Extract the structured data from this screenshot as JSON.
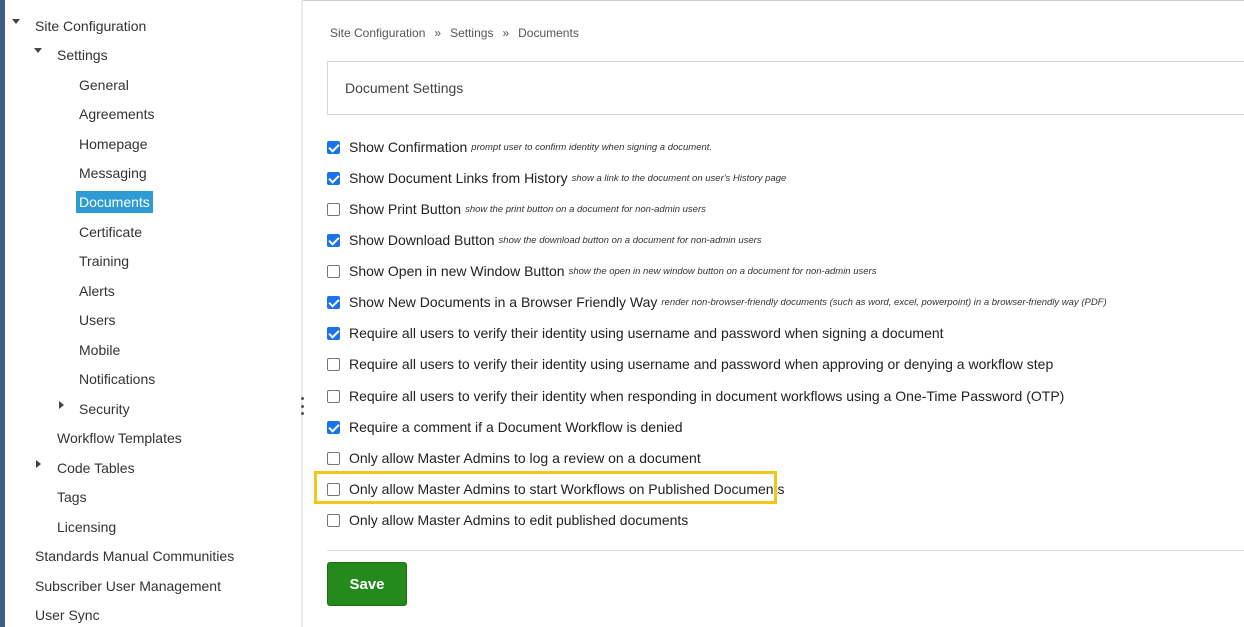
{
  "sidebar": {
    "site_configuration": "Site Configuration",
    "settings": "Settings",
    "settings_items": [
      "General",
      "Agreements",
      "Homepage",
      "Messaging",
      "Documents",
      "Certificate",
      "Training",
      "Alerts",
      "Users",
      "Mobile",
      "Notifications",
      "Security"
    ],
    "active_item": "Documents",
    "workflow_templates": "Workflow Templates",
    "code_tables": "Code Tables",
    "tags": "Tags",
    "licensing": "Licensing",
    "standards_manual_communities": "Standards Manual Communities",
    "subscriber_user_management": "Subscriber User Management",
    "user_sync": "User Sync",
    "active_color": "#2f9bd5"
  },
  "breadcrumb": {
    "items": [
      "Site Configuration",
      "Settings",
      "Documents"
    ],
    "separator": "»"
  },
  "panel": {
    "title": "Document Settings"
  },
  "options": [
    {
      "label": "Show Confirmation",
      "help": "prompt user to confirm identity when signing a document.",
      "checked": true
    },
    {
      "label": "Show Document Links from History",
      "help": "show a link to the document on user's History page",
      "checked": true
    },
    {
      "label": "Show Print Button",
      "help": "show the print button on a document for non-admin users",
      "checked": false
    },
    {
      "label": "Show Download Button",
      "help": "show the download button on a document for non-admin users",
      "checked": true
    },
    {
      "label": "Show Open in new Window Button",
      "help": "show the open in new window button on a document for non-admin users",
      "checked": false
    },
    {
      "label": "Show New Documents in a Browser Friendly Way",
      "help": "render non-browser-friendly documents (such as word, excel, powerpoint) in a browser-friendly way (PDF)",
      "checked": true
    },
    {
      "label": "Require all users to verify their identity using username and password when signing a document",
      "help": "",
      "checked": true
    },
    {
      "label": "Require all users to verify their identity using username and password when approving or denying a workflow step",
      "help": "",
      "checked": false
    },
    {
      "label": "Require all users to verify their identity when responding in document workflows using a One-Time Password (OTP)",
      "help": "",
      "checked": false
    },
    {
      "label": "Require a comment if a Document Workflow is denied",
      "help": "",
      "checked": true
    },
    {
      "label": "Only allow Master Admins to log a review on a document",
      "help": "",
      "checked": false
    },
    {
      "label": "Only allow Master Admins to start Workflows on Published Documents",
      "help": "",
      "checked": false
    },
    {
      "label": "Only allow Master Admins to edit published documents",
      "help": "",
      "checked": false
    }
  ],
  "save_label": "Save",
  "colors": {
    "save": "#248a1e",
    "highlight": "#f5c518",
    "checkbox": "#1a73e8",
    "left_bar": "#3e5c85"
  }
}
